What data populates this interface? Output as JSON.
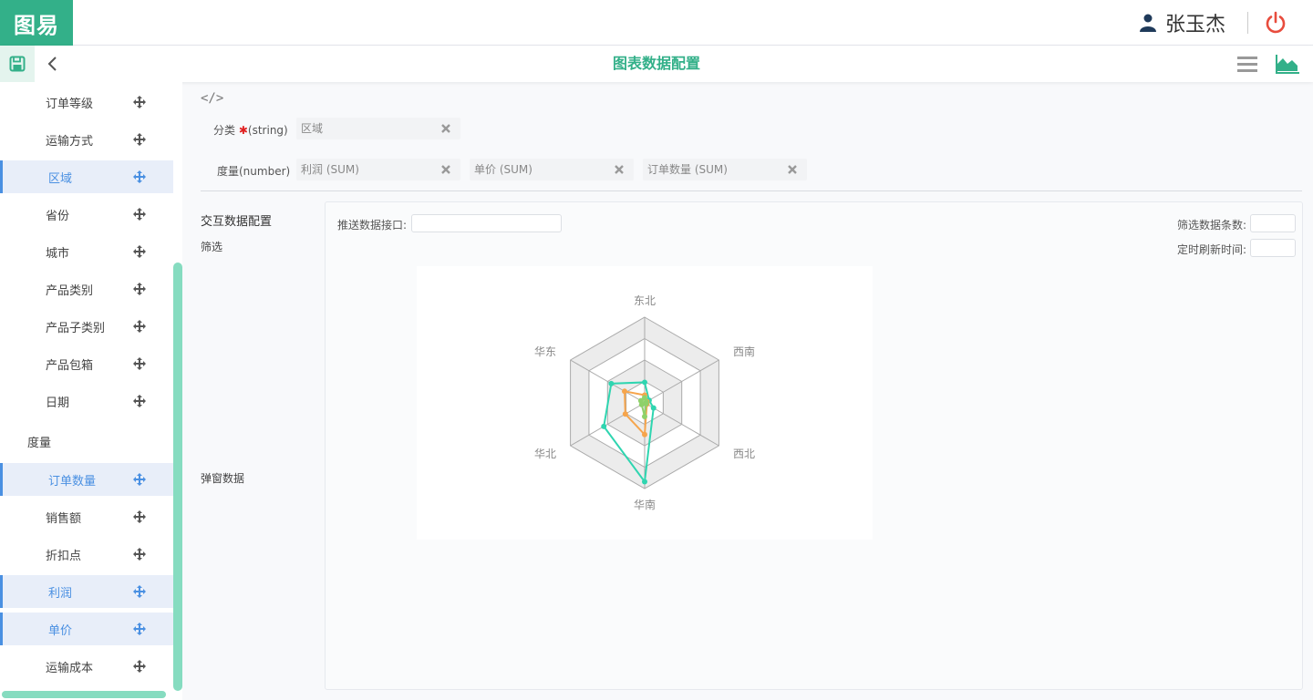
{
  "header": {
    "logo_text": "图易",
    "user_name": "张玉杰"
  },
  "toolbar": {
    "title": "图表数据配置"
  },
  "sidebar": {
    "items": [
      {
        "label": "订单等级",
        "active": false
      },
      {
        "label": "运输方式",
        "active": false
      },
      {
        "label": "区域",
        "active": true
      },
      {
        "label": "省份",
        "active": false
      },
      {
        "label": "城市",
        "active": false
      },
      {
        "label": "产品类别",
        "active": false
      },
      {
        "label": "产品子类别",
        "active": false
      },
      {
        "label": "产品包箱",
        "active": false
      },
      {
        "label": "日期",
        "active": false
      }
    ],
    "measure_group": "度量",
    "measure_items": [
      {
        "label": "订单数量",
        "active": true
      },
      {
        "label": "销售额",
        "active": false
      },
      {
        "label": "折扣点",
        "active": false
      },
      {
        "label": "利润",
        "active": true
      },
      {
        "label": "单价",
        "active": true
      },
      {
        "label": "运输成本",
        "active": false
      }
    ]
  },
  "config": {
    "code_icon": "</>",
    "category_label": "分类",
    "category_required": "✱",
    "category_type": "(string)",
    "category_chip": "区域",
    "measure_label": "度量(number)",
    "measure_chips": [
      "利润 (SUM)",
      "单价 (SUM)",
      "订单数量 (SUM)"
    ]
  },
  "interaction": {
    "title": "交互数据配置",
    "filter_label": "筛选",
    "popup_label": "弹窗数据",
    "push_api_label": "推送数据接口:",
    "filter_count_label": "筛选数据条数:",
    "refresh_label": "定时刷新时间:"
  },
  "chart_data": {
    "type": "radar",
    "indicators": [
      "东北",
      "西南",
      "西北",
      "华南",
      "华北",
      "华东"
    ],
    "series": [
      {
        "color": "#2fd5b0",
        "values": [
          0.24,
          0.06,
          0.12,
          0.92,
          0.55,
          0.45
        ]
      },
      {
        "color": "#f6a54c",
        "values": [
          0.09,
          0.03,
          0.03,
          0.37,
          0.26,
          0.27
        ]
      },
      {
        "color": "#8fd16a",
        "values": [
          0.06,
          0.02,
          0.02,
          0.16,
          0.04,
          0.05
        ]
      }
    ],
    "max": 1,
    "split_number": 4,
    "colors": {
      "accent": "#33b089",
      "active_blue": "#4a90e2",
      "power_red": "#e84c3d"
    }
  }
}
